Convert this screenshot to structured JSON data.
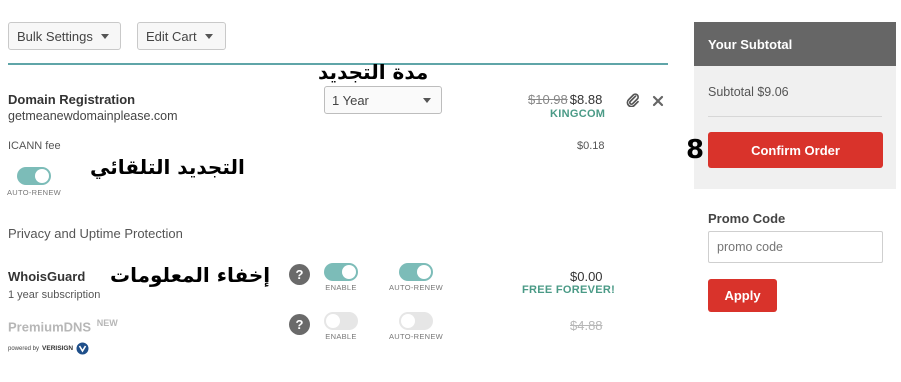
{
  "toolbar": {
    "bulk_settings_label": "Bulk Settings",
    "edit_cart_label": "Edit Cart"
  },
  "annotations": {
    "renewal_period": "مدة التجديد",
    "auto_renewal": "التجديد التلقائي",
    "hide_info": "إخفاء المعلومات",
    "step_number": "8"
  },
  "domain": {
    "title": "Domain Registration",
    "name": "getmeanewdomainplease.com",
    "period_selected": "1 Year",
    "old_price": "$10.98",
    "price": "$8.88",
    "promo_tag": "KINGCOM",
    "icann_label": "ICANN fee",
    "icann_price": "$0.18",
    "auto_renew_label": "AUTO-RENEW",
    "auto_renew_on": true
  },
  "privacy": {
    "section_title": "Privacy and Uptime Protection",
    "whoisguard": {
      "title": "WhoisGuard",
      "subtitle": "1 year subscription",
      "enable_label": "ENABLE",
      "auto_renew_label": "AUTO-RENEW",
      "price": "$0.00",
      "price_note": "FREE FOREVER!",
      "enabled": true,
      "auto_renew_on": true
    },
    "premiumdns": {
      "title": "PremiumDNS",
      "badge": "NEW",
      "enable_label": "ENABLE",
      "auto_renew_label": "AUTO-RENEW",
      "price": "$4.88",
      "powered_by": "powered by",
      "verisign": "VERISIGN",
      "enabled": false,
      "auto_renew_on": false
    }
  },
  "summary": {
    "header": "Your Subtotal",
    "subtotal_text": "Subtotal $9.06",
    "confirm_label": "Confirm Order",
    "promo_title": "Promo Code",
    "promo_placeholder": "promo code",
    "apply_label": "Apply"
  },
  "colors": {
    "accent_teal": "#7cbcb8",
    "confirm_red": "#d9332b",
    "promo_green": "#4a9a86"
  }
}
